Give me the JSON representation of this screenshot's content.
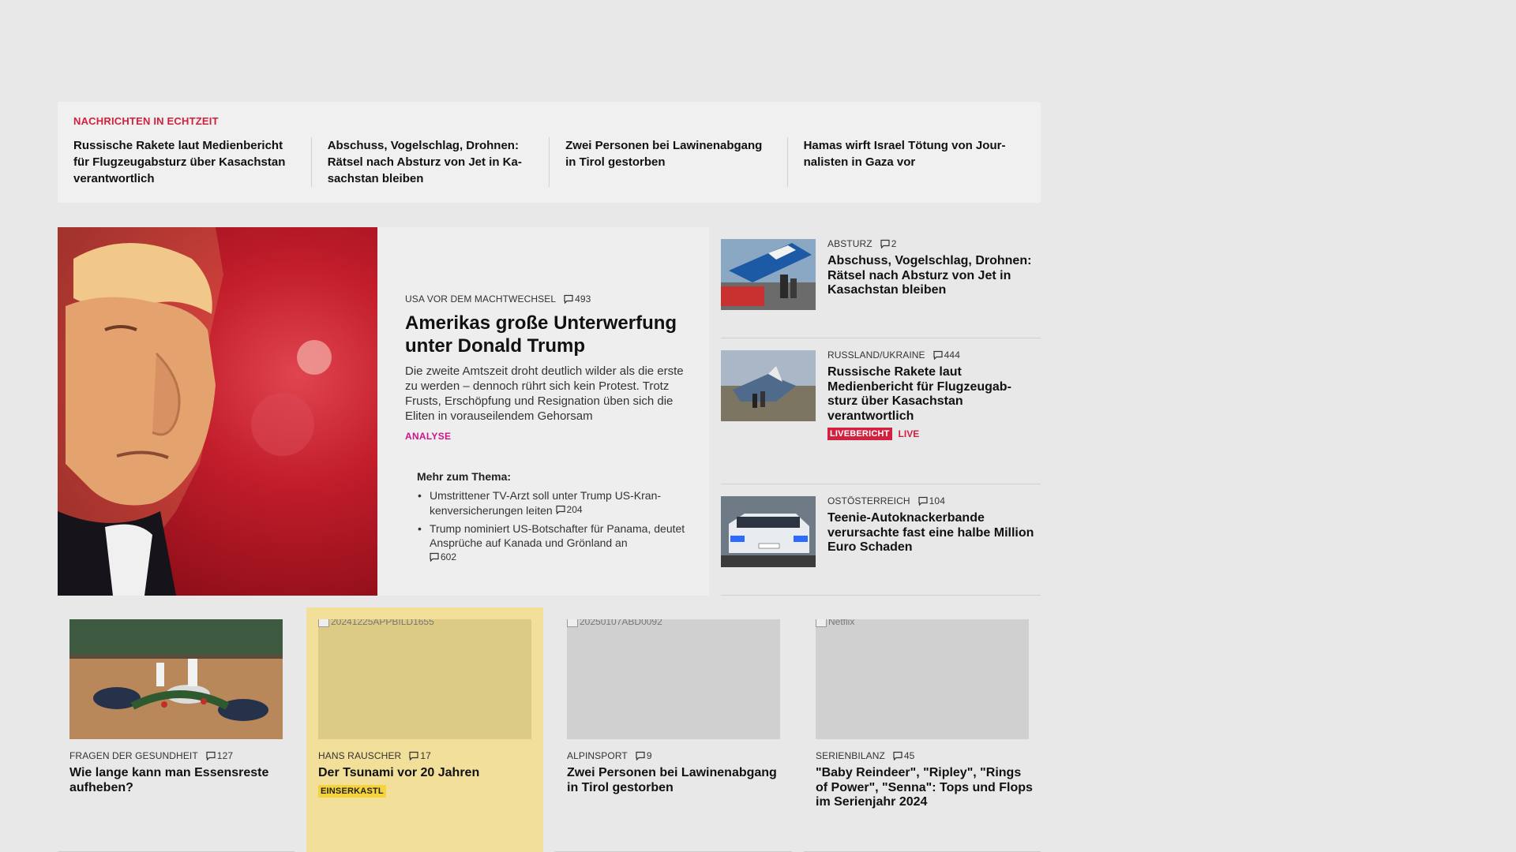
{
  "ticker": {
    "label": "NACHRICHTEN IN ECHTZEIT",
    "items": [
      "Russische Rakete laut Medienbericht für Flugzeugabsturz über Kasachstan verantwortlich",
      "Abschuss, Vogelschlag, Drohnen: Rätsel nach Absturz von Jet in Ka­sachstan bleiben",
      "Zwei Personen bei Lawinenabgang in Tirol gestorben",
      "Hamas wirft Israel Tötung von Jour­nalisten in Gaza vor"
    ]
  },
  "lead": {
    "kicker": "USA VOR DEM MACHTWECHSEL",
    "comments": "493",
    "title": "Amerikas große Unterwerfung unter Donald Trump",
    "teaser": "Die zweite Amtszeit droht deutlich wilder als die erste zu werden – dennoch rührt sich kein Protest. Trotz Frusts, Erschöpfung und Resignation üben sich die Eliten in vorauseilendem Gehorsam",
    "label": "ANALYSE",
    "more_title": "Mehr zum Thema:",
    "more": [
      {
        "text": "Umstrittener TV-Arzt soll unter Trump US-Kran­kenversicherungen leiten",
        "comments": "204"
      },
      {
        "text": "Trump nominiert US-Botschafter für Panama, deutet Ansprüche auf Kanada und Grönland an",
        "comments": "602"
      }
    ]
  },
  "side": [
    {
      "kicker": "ABSTURZ",
      "comments": "2",
      "title": "Abschuss, Vogelschlag, Drohnen: Rätsel nach Absturz von Jet in Kasachstan bleiben"
    },
    {
      "kicker": "RUSSLAND/UKRAINE",
      "comments": "444",
      "title": "Russische Rakete laut Medienbericht für Flugzeugab­sturz über Kasachstan verantwortlich",
      "badge": "LIVEBERICHT",
      "live": "LIVE"
    },
    {
      "kicker": "OSTÖSTERREICH",
      "comments": "104",
      "title": "Teenie-Autoknackerbande verursachte fast eine halbe Million Euro Schaden"
    }
  ],
  "bottom": [
    {
      "kicker": "FRAGEN DER GESUNDHEIT",
      "comments": "127",
      "title": "Wie lange kann man Essensreste aufheben?"
    },
    {
      "kicker": "HANS RAUSCHER",
      "comments": "17",
      "title": "Der Tsunami vor 20 Jahren",
      "tag": "EINSERKASTL",
      "img_alt": "20241225APPBILD1655"
    },
    {
      "kicker": "ALPINSPORT",
      "comments": "9",
      "title": "Zwei Personen bei Lawinenabgang in Tirol gestorben",
      "img_alt": "20250107ABD0092"
    },
    {
      "kicker": "SERIENBILANZ",
      "comments": "45",
      "title": "\"Baby Reindeer\", \"Ripley\", \"Rings of Power\", \"Senna\": Tops und Flops im Serienjahr 2024",
      "img_alt": "Netflix"
    }
  ],
  "colors": {
    "background": "#e8e8e8",
    "ticker_label": "#d1213f",
    "analyse": "#c8168d",
    "live": "#d1213f",
    "highlight_card": "#f2df9a",
    "tag_yellow": "#f5d43b"
  },
  "icons": {
    "comment": "comment-bubble-icon"
  }
}
